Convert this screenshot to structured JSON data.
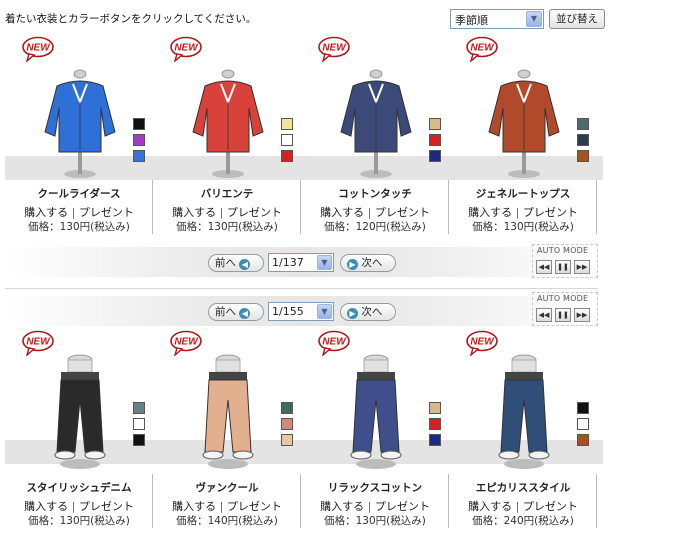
{
  "header": {
    "instruction": "着たい衣装とカラーボタンをクリックしてください。",
    "sort_value": "季節順",
    "sort_button": "並び替え"
  },
  "actions": {
    "buy": "購入する",
    "separator": "|",
    "present": "プレゼント"
  },
  "badge": "NEW",
  "tops": {
    "items": [
      {
        "name": "クールライダース",
        "price": "価格：130円(税込み)",
        "swatches": [
          "#111111",
          "#a03cc8",
          "#3b73d6"
        ],
        "body_color": "#2f6fd8"
      },
      {
        "name": "バリエンテ",
        "price": "価格：130円(税込み)",
        "swatches": [
          "#f2e59a",
          "#ffffff",
          "#d42020"
        ],
        "body_color": "#d9423a"
      },
      {
        "name": "コットンタッチ",
        "price": "価格：120円(税込み)",
        "swatches": [
          "#d7b98c",
          "#d32020",
          "#1c2a80"
        ],
        "body_color": "#3c4a7a"
      },
      {
        "name": "ジェネルートップス",
        "price": "価格：130円(税込み)",
        "swatches": [
          "#4f6b6a",
          "#2e3b4f",
          "#a3531f"
        ],
        "body_color": "#b04a2a"
      }
    ],
    "pager": {
      "prev": "前へ",
      "page": "1/137",
      "next": "次へ"
    },
    "auto_mode": "AUTO MODE"
  },
  "bottoms": {
    "items": [
      {
        "name": "スタイリッシュデニム",
        "price": "価格：130円(税込み)",
        "swatches": [
          "#6b7f86",
          "#ffffff",
          "#111111"
        ],
        "body_color": "#2a2a2a"
      },
      {
        "name": "ヴァンクール",
        "price": "価格：140円(税込み)",
        "swatches": [
          "#3f6b5e",
          "#d28a7a",
          "#e7c8a4"
        ],
        "body_color": "#e3b08f"
      },
      {
        "name": "リラックスコットン",
        "price": "価格：130円(税込み)",
        "swatches": [
          "#d7b98c",
          "#d32020",
          "#1c2a80"
        ],
        "body_color": "#3f4f8c"
      },
      {
        "name": "エピカリススタイル",
        "price": "価格：240円(税込み)",
        "swatches": [
          "#111111",
          "#ffffff",
          "#a3531f"
        ],
        "body_color": "#2f4f78"
      }
    ],
    "pager": {
      "prev": "前へ",
      "page": "1/155",
      "next": "次へ"
    },
    "auto_mode": "AUTO MODE"
  }
}
